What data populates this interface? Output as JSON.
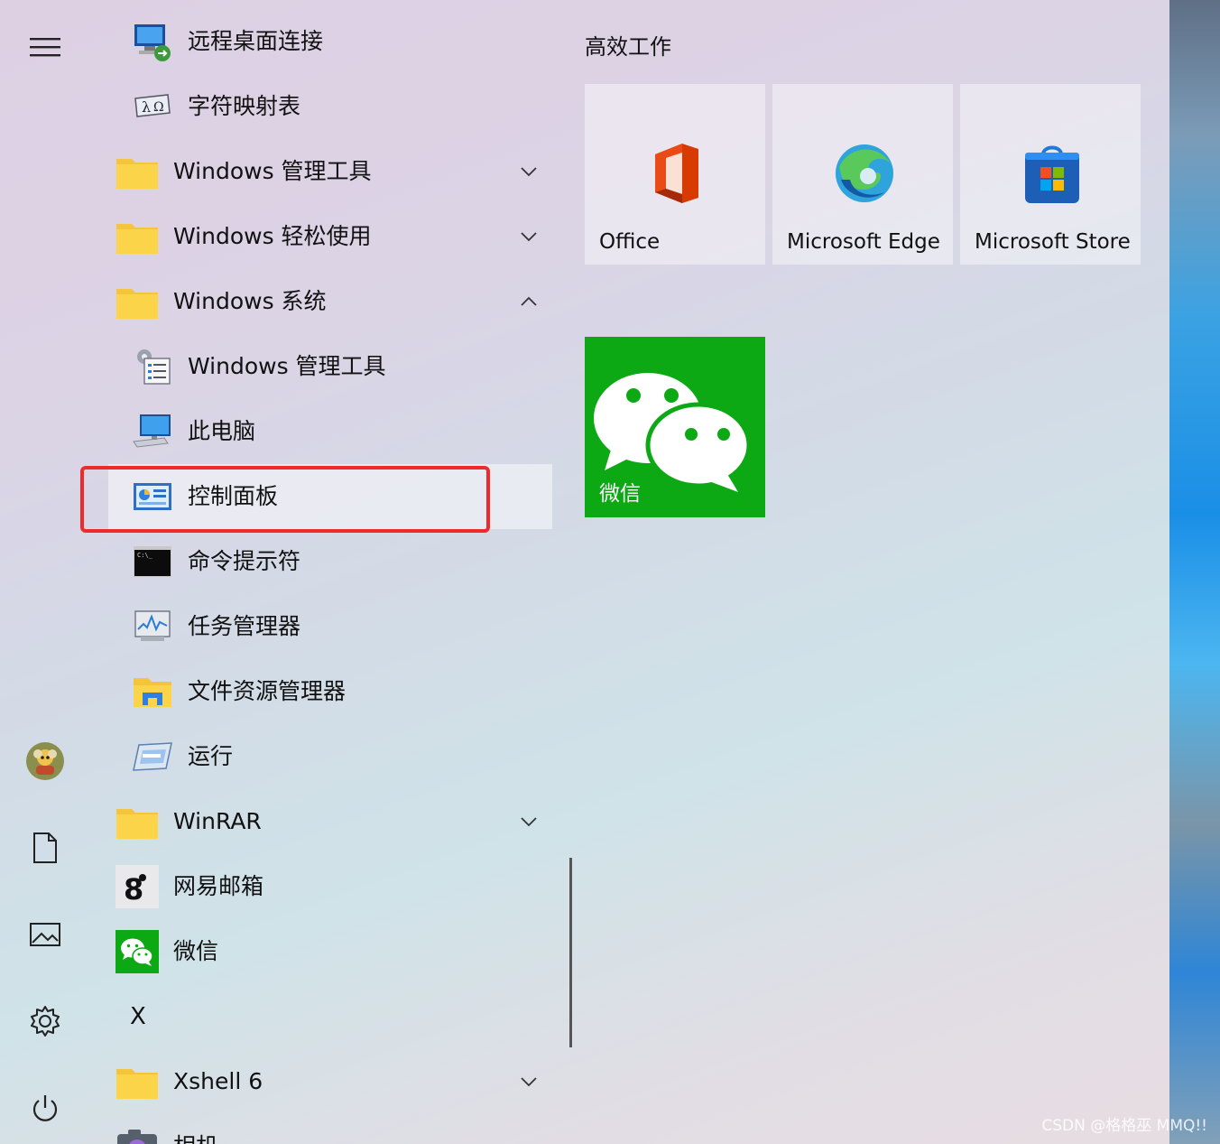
{
  "rail": {
    "items": [
      {
        "name": "menu-icon"
      },
      {
        "name": "avatar"
      },
      {
        "name": "document-icon"
      },
      {
        "name": "pictures-icon"
      },
      {
        "name": "settings-gear-icon"
      },
      {
        "name": "power-icon"
      }
    ]
  },
  "app_list": {
    "items": [
      {
        "label": "远程桌面连接",
        "icon": "remote-desktop-icon"
      },
      {
        "label": "字符映射表",
        "icon": "character-map-icon"
      },
      {
        "label": "Windows 管理工具",
        "icon": "folder-icon",
        "expand": "collapsed"
      },
      {
        "label": "Windows 轻松使用",
        "icon": "folder-icon",
        "expand": "collapsed"
      },
      {
        "label": "Windows 系统",
        "icon": "folder-icon",
        "expand": "expanded"
      },
      {
        "label": "Windows 管理工具",
        "icon": "admin-tools-icon"
      },
      {
        "label": "此电脑",
        "icon": "this-pc-icon"
      },
      {
        "label": "控制面板",
        "icon": "control-panel-icon",
        "selected": true
      },
      {
        "label": "命令提示符",
        "icon": "command-prompt-icon"
      },
      {
        "label": "任务管理器",
        "icon": "task-manager-icon"
      },
      {
        "label": "文件资源管理器",
        "icon": "file-explorer-icon"
      },
      {
        "label": "运行",
        "icon": "run-icon"
      },
      {
        "label": "WinRAR",
        "icon": "folder-icon",
        "expand": "collapsed"
      },
      {
        "label": "网易邮箱",
        "icon": "netease-mail-icon"
      },
      {
        "label": "微信",
        "icon": "wechat-icon"
      },
      {
        "label": "X",
        "icon": ""
      },
      {
        "label": "Xshell 6",
        "icon": "folder-icon",
        "expand": "collapsed"
      },
      {
        "label": "相机",
        "icon": "camera-icon"
      }
    ]
  },
  "tiles": {
    "group_title": "高效工作",
    "items": [
      {
        "label": "Office",
        "icon": "office-icon"
      },
      {
        "label": "Microsoft Edge",
        "icon": "edge-icon"
      },
      {
        "label": "Microsoft Store",
        "icon": "store-icon"
      },
      {
        "label": "微信",
        "icon": "wechat-icon",
        "color": "#0ca915"
      }
    ]
  },
  "colors": {
    "highlight": "#ef2a2a",
    "wechat_green": "#0ca915",
    "folder_yellow": "#f9cf3c"
  },
  "watermark": "CSDN @格格巫 MMQ!!"
}
